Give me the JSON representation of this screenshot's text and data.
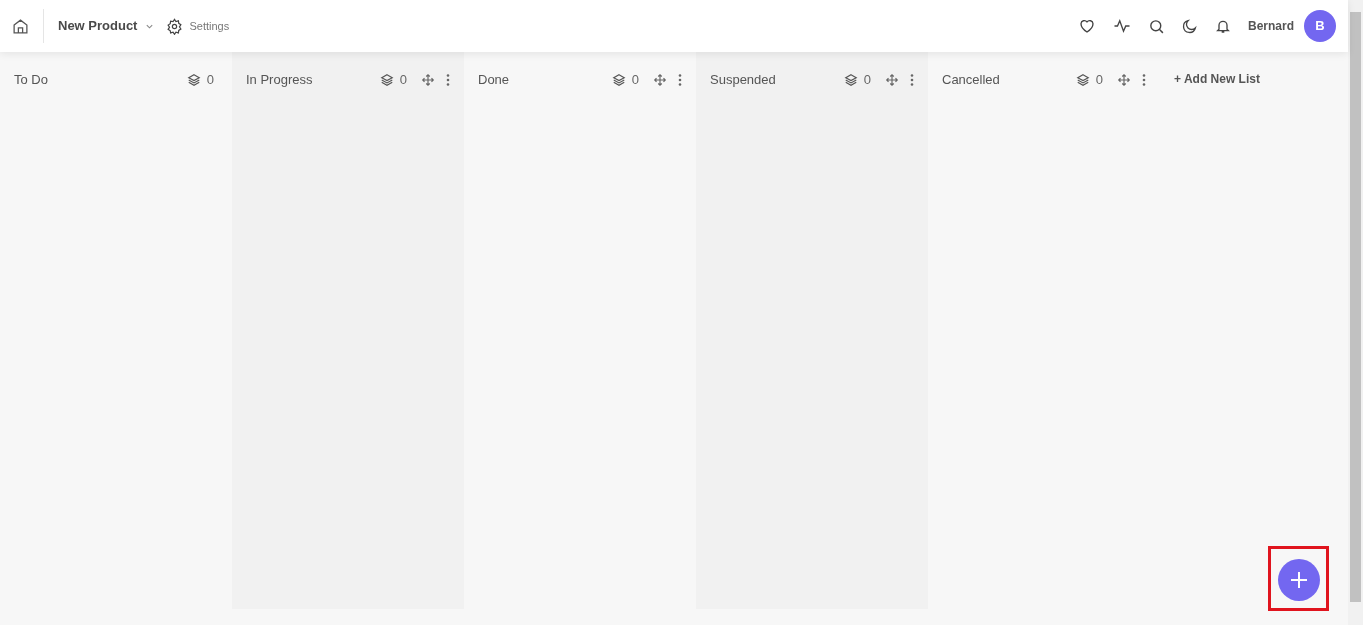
{
  "header": {
    "project": "New Product",
    "settings": "Settings",
    "user": "Bernard",
    "avatar": "B"
  },
  "lists": [
    {
      "title": "To Do",
      "count": "0",
      "movable": false
    },
    {
      "title": "In Progress",
      "count": "0",
      "movable": true
    },
    {
      "title": "Done",
      "count": "0",
      "movable": true
    },
    {
      "title": "Suspended",
      "count": "0",
      "movable": true
    },
    {
      "title": "Cancelled",
      "count": "0",
      "movable": true
    }
  ],
  "add_list": "+ Add New List"
}
